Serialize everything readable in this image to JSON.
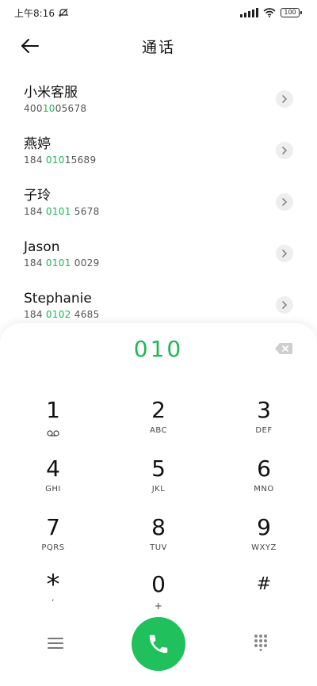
{
  "status_bar": {
    "time": "上午8:16",
    "battery": "100"
  },
  "header": {
    "title": "通话"
  },
  "contacts": [
    {
      "name": "小米客服",
      "num_pre": "400",
      "num_hl": "10",
      "num_post": "05678"
    },
    {
      "name": "燕婷",
      "num_pre": "184 ",
      "num_hl": "010",
      "num_post": "15689"
    },
    {
      "name": "子玲",
      "num_pre": "184 ",
      "num_hl": "0101",
      "num_post": " 5678"
    },
    {
      "name": "Jason",
      "num_pre": "184 ",
      "num_hl": "0101",
      "num_post": " 0029"
    },
    {
      "name": "Stephanie",
      "num_pre": "184 ",
      "num_hl": "0102",
      "num_post": " 4685"
    }
  ],
  "dialer": {
    "display": "010",
    "keys": [
      {
        "digit": "1",
        "sub": ""
      },
      {
        "digit": "2",
        "sub": "ABC"
      },
      {
        "digit": "3",
        "sub": "DEF"
      },
      {
        "digit": "4",
        "sub": "GHI"
      },
      {
        "digit": "5",
        "sub": "JKL"
      },
      {
        "digit": "6",
        "sub": "MNO"
      },
      {
        "digit": "7",
        "sub": "PQRS"
      },
      {
        "digit": "8",
        "sub": "TUV"
      },
      {
        "digit": "9",
        "sub": "WXYZ"
      },
      {
        "digit": "*",
        "sub": ","
      },
      {
        "digit": "0",
        "sub": "+"
      },
      {
        "digit": "#",
        "sub": ""
      }
    ]
  },
  "colors": {
    "accent": "#1db954",
    "call_button": "#20c05c"
  }
}
